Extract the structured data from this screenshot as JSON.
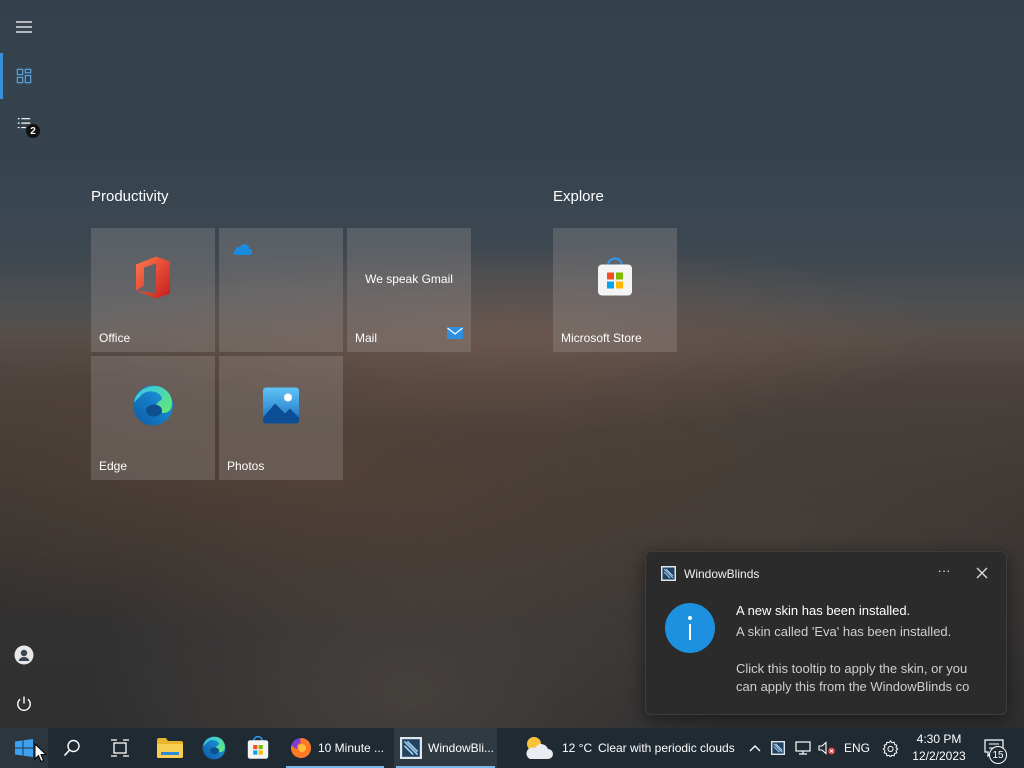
{
  "start_menu": {
    "rail": {
      "menu_icon": "hamburger-icon",
      "pinned_icon": "tiles-icon",
      "all_apps_icon": "list-icon",
      "all_apps_badge": "2",
      "user_icon": "user-icon",
      "power_icon": "power-icon"
    },
    "groups": [
      {
        "title": "Productivity",
        "tiles": [
          {
            "label": "Office",
            "icon": "office-icon"
          },
          {
            "label": "",
            "icon": "onedrive-icon"
          },
          {
            "label": "Mail",
            "text": "We speak Gmail",
            "icon": "mail-icon"
          },
          {
            "label": "Edge",
            "icon": "edge-icon"
          },
          {
            "label": "Photos",
            "icon": "photos-icon"
          }
        ]
      },
      {
        "title": "Explore",
        "tiles": [
          {
            "label": "Microsoft Store",
            "icon": "store-icon"
          }
        ]
      }
    ]
  },
  "toast": {
    "app_name": "WindowBlinds",
    "more_label": "···",
    "title": "A new skin has been installed.",
    "line1": "A skin called 'Eva' has been installed.",
    "line2": "Click this tooltip to apply the skin, or you",
    "line3": "can apply this from the WindowBlinds co"
  },
  "taskbar": {
    "start_icon": "windows-icon",
    "search_icon": "search-icon",
    "task_view_icon": "task-view-icon",
    "pinned": [
      "file-explorer-icon",
      "edge-icon",
      "store-icon"
    ],
    "running_apps": [
      {
        "label": "10 Minute ...",
        "icon": "firefox-icon",
        "active": false
      },
      {
        "label": "WindowBli...",
        "icon": "windowblinds-icon",
        "active": true
      }
    ],
    "weather": {
      "icon": "weather-partly-cloudy-icon",
      "temperature": "12 °C",
      "condition": "Clear with periodic clouds"
    },
    "tray": {
      "chevron_icon": "chevron-up-icon",
      "language": "ENG",
      "time": "4:30 PM",
      "date": "12/2/2023",
      "notification_count": "15"
    }
  },
  "colors": {
    "accent": "#3a8fd9",
    "taskbar": "#1f2a33",
    "toast_bg": "#2b2b2b",
    "info_blue": "#1e90e0"
  }
}
